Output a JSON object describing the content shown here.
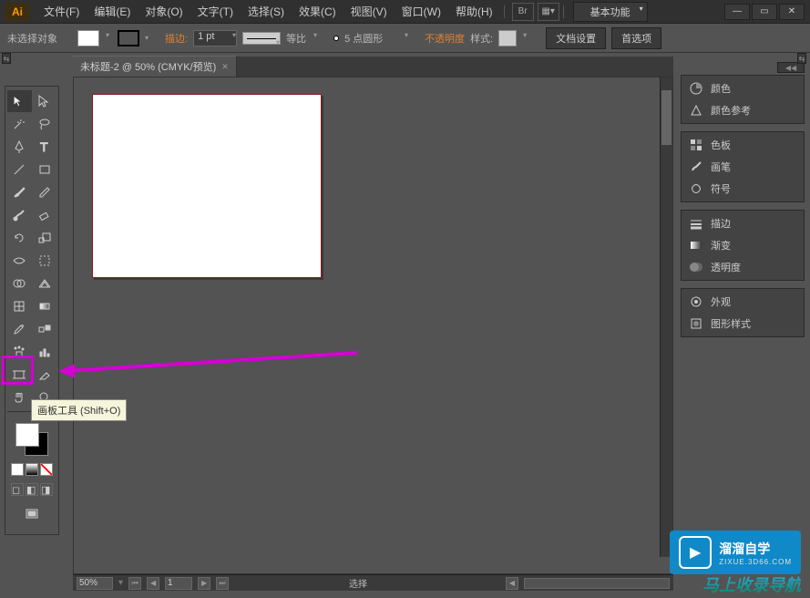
{
  "app": {
    "logo": "Ai"
  },
  "menu": {
    "file": "文件(F)",
    "edit": "编辑(E)",
    "object": "对象(O)",
    "type": "文字(T)",
    "select": "选择(S)",
    "effect": "效果(C)",
    "view": "视图(V)",
    "window": "窗口(W)",
    "help": "帮助(H)"
  },
  "workspace": {
    "label": "基本功能"
  },
  "control": {
    "no_selection": "未选择对象",
    "stroke_label": "描边:",
    "stroke_weight": "1 pt",
    "uniform": "等比",
    "brush_value": "5 点圆形",
    "opacity_label": "不透明度",
    "style_label": "样式:",
    "doc_setup": "文档设置",
    "preferences": "首选项"
  },
  "document": {
    "tab_title": "未标题-2 @ 50% (CMYK/预览)"
  },
  "status": {
    "zoom": "50%",
    "page": "1",
    "mode": "选择"
  },
  "tooltip": {
    "artboard_tool": "画板工具 (Shift+O)"
  },
  "panels": {
    "color": "颜色",
    "color_guide": "颜色参考",
    "swatches": "色板",
    "brushes": "画笔",
    "symbols": "符号",
    "stroke": "描边",
    "gradient": "渐变",
    "transparency": "透明度",
    "appearance": "外观",
    "graphic_styles": "图形样式"
  },
  "watermark": {
    "title": "溜溜自学",
    "sub": "ZIXUE.3D66.COM",
    "bottom": "马上收录导航"
  }
}
